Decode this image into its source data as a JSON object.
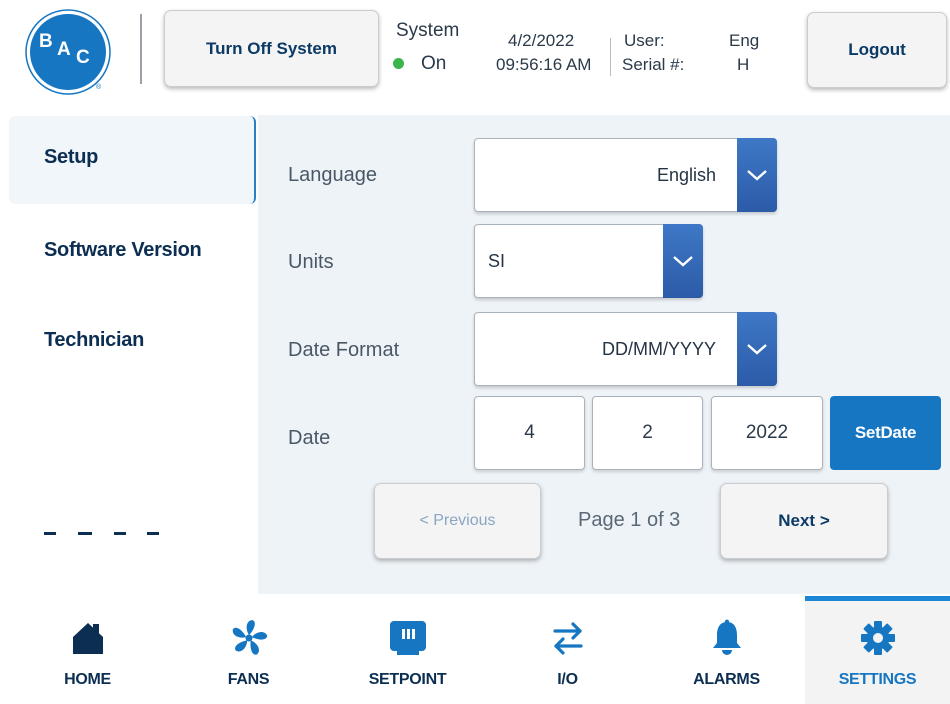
{
  "brand": {
    "logo_text": "BAC",
    "logo_mark": "®",
    "primary_color": "#1676c2"
  },
  "header": {
    "turn_off_label": "Turn Off System",
    "system_label": "System",
    "system_state": "On",
    "system_state_color": "#3bb54a",
    "date": "4/2/2022",
    "time": "09:56:16 AM",
    "user_key": "User:",
    "user_value": "Eng",
    "serial_key": "Serial #:",
    "serial_value": "H",
    "logout_label": "Logout"
  },
  "sidebar": {
    "items": [
      {
        "label": "Setup",
        "active": true
      },
      {
        "label": "Software Version",
        "active": false
      },
      {
        "label": "Technician",
        "active": false
      }
    ]
  },
  "settings": {
    "language": {
      "label": "Language",
      "value": "English"
    },
    "units": {
      "label": "Units",
      "value": "SI"
    },
    "date_format": {
      "label": "Date Format",
      "value": "DD/MM/YYYY"
    },
    "date": {
      "label": "Date",
      "day": "4",
      "month": "2",
      "year": "2022",
      "set_label": "SetDate"
    }
  },
  "pagination": {
    "previous_label": "< Previous",
    "next_label": "Next >",
    "page_text": "Page 1 of 3",
    "current_page": 1,
    "total_pages": 3
  },
  "bottom_nav": {
    "items": [
      {
        "label": "HOME",
        "icon": "home-icon",
        "active": false
      },
      {
        "label": "FANS",
        "icon": "fan-icon",
        "active": false
      },
      {
        "label": "SETPOINT",
        "icon": "setpoint-icon",
        "active": false
      },
      {
        "label": "I/O",
        "icon": "io-arrows-icon",
        "active": false
      },
      {
        "label": "ALARMS",
        "icon": "bell-icon",
        "active": false
      },
      {
        "label": "SETTINGS",
        "icon": "gear-icon",
        "active": true
      }
    ]
  }
}
